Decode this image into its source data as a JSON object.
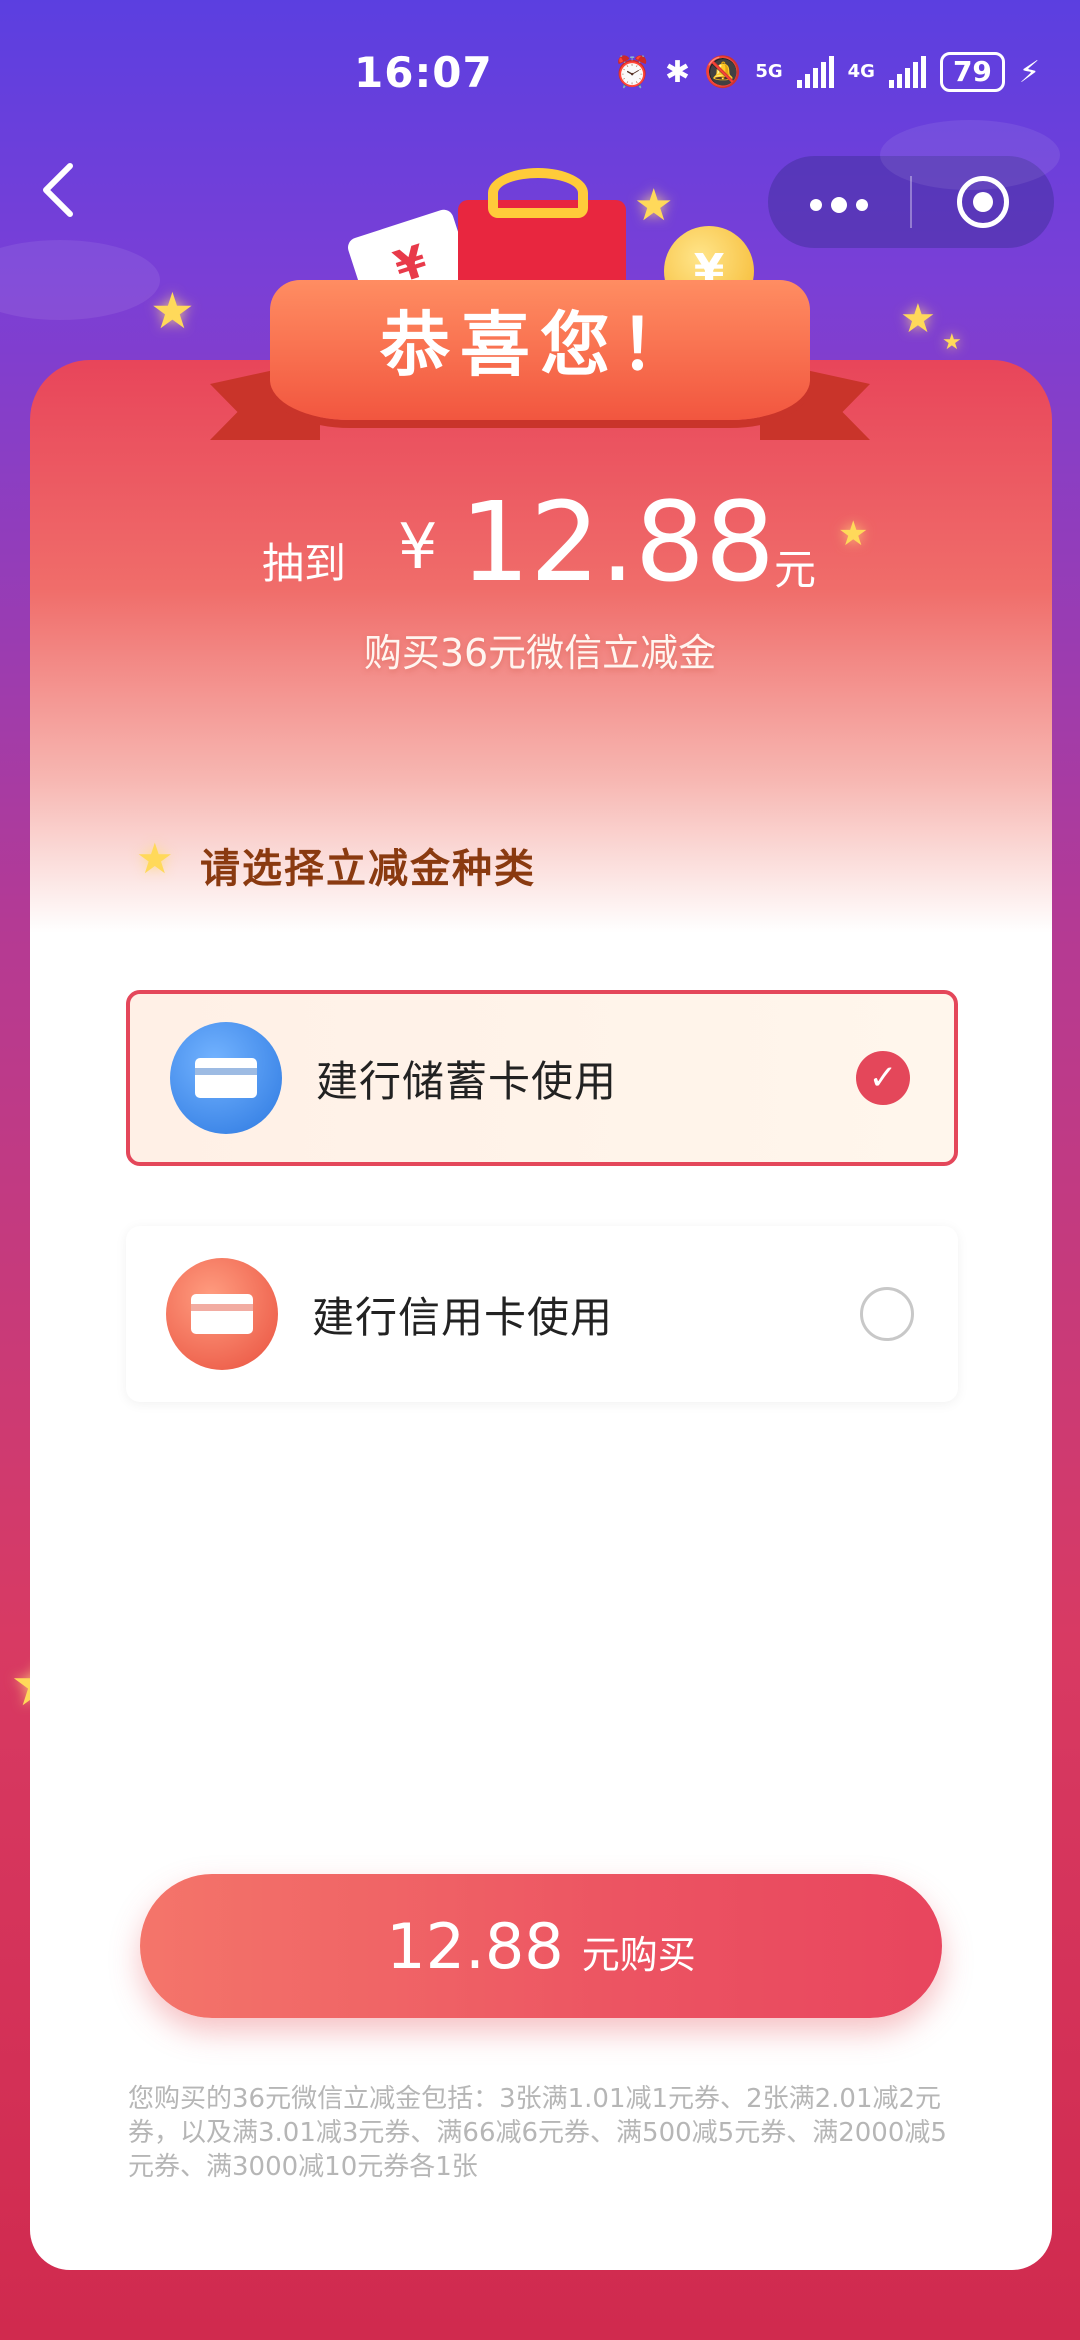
{
  "status_bar": {
    "time": "16:07",
    "network_1": "5G",
    "network_2": "4G",
    "battery": "79"
  },
  "nav": {
    "back_icon": "chevron-left-icon",
    "more_icon": "more-dots-icon",
    "close_icon": "target-circle-icon"
  },
  "banner": {
    "title": "恭喜您！",
    "money_card_symbol": "¥",
    "coin_symbol": "¥"
  },
  "prize": {
    "prefix": "抽到",
    "currency": "¥",
    "amount": "12.88",
    "unit": "元",
    "description": "购买36元微信立减金"
  },
  "section": {
    "title": "请选择立减金种类"
  },
  "options": [
    {
      "label": "建行储蓄卡使用",
      "selected": true,
      "icon": "debit-card-icon",
      "accent": "#2c78e0"
    },
    {
      "label": "建行信用卡使用",
      "selected": false,
      "icon": "credit-card-icon",
      "accent": "#e9503e"
    }
  ],
  "buy_button": {
    "amount": "12.88",
    "label": "元购买"
  },
  "footnote": "您购买的36元微信立减金包括：3张满1.01减1元券、2张满2.01减2元券，以及满3.01减3元券、满66减6元券、满500减5元券、满2000减5元券、满3000减10元券各1张",
  "colors": {
    "accent": "#e4475a",
    "section_title": "#8a3a10",
    "background_top": "#5b3fe0",
    "background_bottom": "#d02a4e"
  }
}
